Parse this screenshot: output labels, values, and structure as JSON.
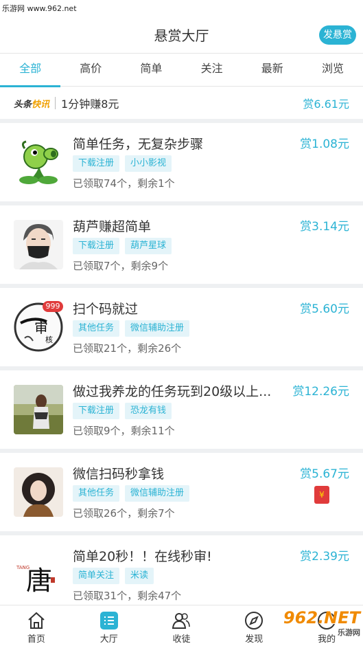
{
  "watermark": "乐游网 www.962.net",
  "header": {
    "title": "悬赏大厅",
    "post_button": "发悬赏"
  },
  "tabs": [
    {
      "label": "全部",
      "active": true
    },
    {
      "label": "高价",
      "active": false
    },
    {
      "label": "简单",
      "active": false
    },
    {
      "label": "关注",
      "active": false
    },
    {
      "label": "最新",
      "active": false
    },
    {
      "label": "浏览",
      "active": false
    }
  ],
  "news": {
    "brand_a": "头条",
    "brand_b": "快讯",
    "text": "1分钟赚8元",
    "reward": "赏6.61元"
  },
  "tasks": [
    {
      "title": "简单任务，无复杂步骤",
      "reward": "赏1.08元",
      "tags": [
        "下载注册",
        "小小影视"
      ],
      "stat": "已领取74个，剩余1个"
    },
    {
      "title": "葫芦赚超简单",
      "reward": "赏3.14元",
      "tags": [
        "下载注册",
        "葫芦星球"
      ],
      "stat": "已领取7个，剩余9个"
    },
    {
      "title": "扫个码就过",
      "reward": "赏5.60元",
      "tags": [
        "其他任务",
        "微信辅助注册"
      ],
      "stat": "已领取21个，剩余26个",
      "badge": "999"
    },
    {
      "title": "做过我养龙的任务玩到20级以上...",
      "reward": "赏12.26元",
      "tags": [
        "下载注册",
        "恐龙有钱"
      ],
      "stat": "已领取9个，剩余11个"
    },
    {
      "title": "微信扫码秒拿钱",
      "reward": "赏5.67元",
      "tags": [
        "其他任务",
        "微信辅助注册"
      ],
      "stat": "已领取26个，剩余7个",
      "redpacket": "¥"
    },
    {
      "title": "简单20秒！！在线秒审!",
      "reward": "赏2.39元",
      "tags": [
        "简单关注",
        "米读"
      ],
      "stat": "已领取31个，剩余47个"
    }
  ],
  "nav": [
    {
      "label": "首页"
    },
    {
      "label": "大厅"
    },
    {
      "label": "收徒"
    },
    {
      "label": "发现"
    },
    {
      "label": "我的"
    }
  ],
  "logo": {
    "main": "962.NET",
    "sub": "乐游网"
  },
  "colors": {
    "accent": "#2bb3d4",
    "red": "#e03b3b"
  }
}
